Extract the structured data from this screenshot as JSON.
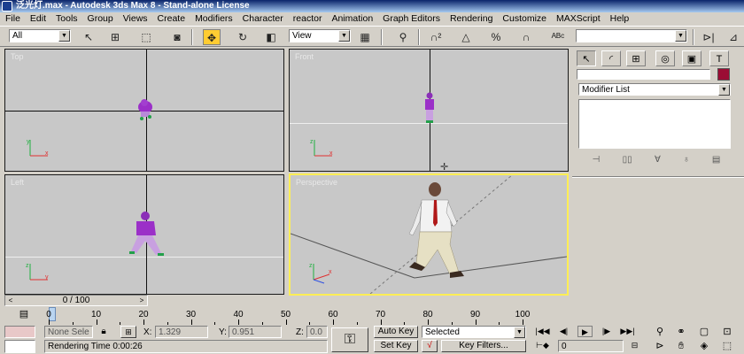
{
  "window": {
    "title": "泛光灯.max - Autodesk 3ds Max 8 - Stand-alone License"
  },
  "menu": [
    "File",
    "Edit",
    "Tools",
    "Group",
    "Views",
    "Create",
    "Modifiers",
    "Character",
    "reactor",
    "Animation",
    "Graph Editors",
    "Rendering",
    "Customize",
    "MAXScript",
    "Help"
  ],
  "toolbar": {
    "selection_filter": "All",
    "reference_coord": "View",
    "named_selection": ""
  },
  "viewports": {
    "top": {
      "label": "Top"
    },
    "front": {
      "label": "Front"
    },
    "left": {
      "label": "Left"
    },
    "perspective": {
      "label": "Perspective"
    }
  },
  "axis": {
    "x": "x",
    "y": "y",
    "z": "z"
  },
  "command_panel": {
    "object_name": "",
    "object_color": "#9b0c34",
    "modifier_list": "Modifier List"
  },
  "timeline": {
    "frame_display": "0 / 100",
    "prev_arrow": "<",
    "next_arrow": ">",
    "ticks": [
      "0",
      "10",
      "20",
      "30",
      "40",
      "50",
      "60",
      "70",
      "80",
      "90",
      "100"
    ]
  },
  "status": {
    "selection": "None Sele",
    "x_label": "X:",
    "x_value": "1.329",
    "y_label": "Y:",
    "y_value": "0.951",
    "z_label": "Z:",
    "z_value": "0.0",
    "render_time": "Rendering Time  0:00:26",
    "auto_key": "Auto Key",
    "set_key": "Set Key",
    "key_mode": "Selected",
    "key_filters": "Key Filters...",
    "current_frame": "0"
  }
}
